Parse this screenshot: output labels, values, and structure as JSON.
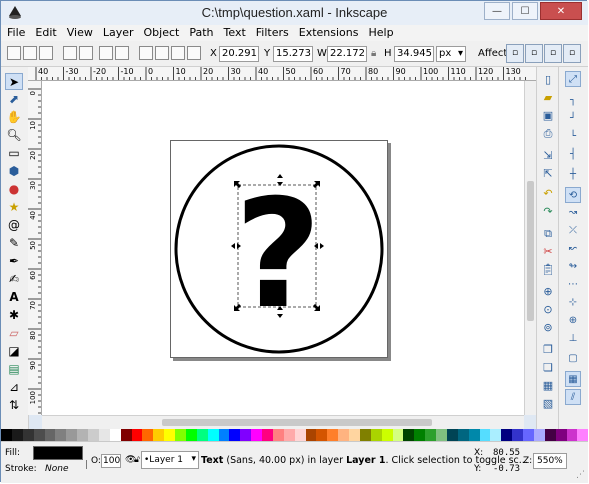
{
  "window": {
    "title": "C:\\tmp\\question.xaml - Inkscape"
  },
  "window_controls": {
    "minimize": "—",
    "maximize": "☐",
    "close": "✕"
  },
  "menu": [
    "File",
    "Edit",
    "View",
    "Layer",
    "Object",
    "Path",
    "Text",
    "Filters",
    "Extensions",
    "Help"
  ],
  "toolbar": {
    "x_label": "X",
    "x_value": "20.291",
    "y_label": "Y",
    "y_value": "15.273",
    "w_label": "W",
    "w_value": "22.172",
    "h_label": "H",
    "h_value": "34.945",
    "unit": "px",
    "affect_label": "Affect:"
  },
  "ruler_top_labels": [
    "40",
    "-30",
    "-20",
    "-10",
    "0",
    "10",
    "20",
    "30",
    "40",
    "50",
    "60",
    "70",
    "80",
    "90",
    "100",
    "110",
    "120",
    "130"
  ],
  "ruler_left_labels": [
    "0",
    "10",
    "20",
    "30",
    "40",
    "50",
    "60",
    "70",
    "80",
    "90",
    "100"
  ],
  "drawing": {
    "glyph": "?"
  },
  "palette": [
    "#000000",
    "#1a1a1a",
    "#333333",
    "#4d4d4d",
    "#666666",
    "#808080",
    "#999999",
    "#b3b3b3",
    "#cccccc",
    "#e6e6e6",
    "#ffffff",
    "#800000",
    "#ff0000",
    "#ff6600",
    "#ffcc00",
    "#ffff00",
    "#80ff00",
    "#00ff00",
    "#00ff80",
    "#00ffff",
    "#0080ff",
    "#0000ff",
    "#8000ff",
    "#ff00ff",
    "#ff0080",
    "#ff8080",
    "#ffaaaa",
    "#ffd5d5",
    "#aa4400",
    "#d45500",
    "#ff7f2a",
    "#ffb380",
    "#ffd5a0",
    "#808000",
    "#aad400",
    "#ccff00",
    "#d4ff80",
    "#004400",
    "#008000",
    "#2ca02c",
    "#80c080",
    "#004455",
    "#006680",
    "#0088aa",
    "#55ddff",
    "#aaeeff",
    "#000080",
    "#3333cc",
    "#6666ff",
    "#aaaaff",
    "#440044",
    "#800080",
    "#cc33cc",
    "#ff80ff"
  ],
  "status": {
    "fill_label": "Fill:",
    "stroke_label": "Stroke:",
    "stroke_value": "None",
    "opacity_label": "O:",
    "opacity_value": "100",
    "layer_value": "•Layer 1",
    "message_prefix": "Text",
    "message_detail": "(Sans, 40.00 px) in layer",
    "message_layer": "Layer 1",
    "message_suffix": ". Click selection to toggle sc...",
    "x_label": "X:",
    "x_value": "80.55",
    "y_label": "Y:",
    "y_value": "-0.73",
    "zoom_label": "Z:",
    "zoom_value": "550%"
  }
}
